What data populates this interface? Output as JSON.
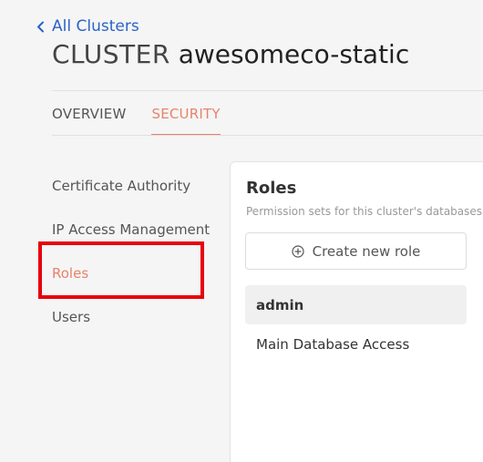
{
  "nav": {
    "back_label": "All Clusters"
  },
  "page": {
    "title_prefix": "CLUSTER",
    "title_name": "awesomeco-static"
  },
  "tabs": [
    {
      "label": "OVERVIEW",
      "active": false
    },
    {
      "label": "SECURITY",
      "active": true
    }
  ],
  "sidebar": {
    "items": [
      {
        "label": "Certificate Authority",
        "active": false
      },
      {
        "label": "IP Access Management",
        "active": false
      },
      {
        "label": "Roles",
        "active": true
      },
      {
        "label": "Users",
        "active": false
      }
    ]
  },
  "roles_panel": {
    "title": "Roles",
    "subtitle": "Permission sets for this cluster's databases",
    "create_button_label": "Create new role",
    "group_label": "admin",
    "roles": [
      "Main Database Access"
    ]
  },
  "colors": {
    "accent": "#e8826b",
    "link": "#2b63c6",
    "highlight": "#e8000b"
  },
  "icons": {
    "back": "chevron-left-icon",
    "create": "plus-circle-icon"
  }
}
